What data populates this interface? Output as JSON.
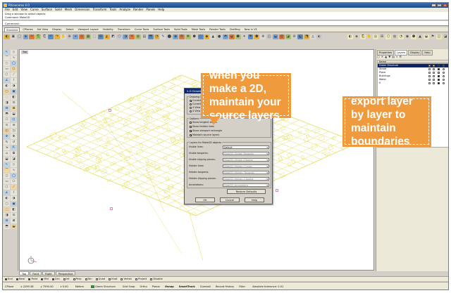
{
  "window": {
    "title": "Rhinoceros 4.0",
    "controls": [
      "_",
      "□",
      "x"
    ]
  },
  "menu": [
    "File",
    "Edit",
    "View",
    "Curve",
    "Surface",
    "Solid",
    "Mesh",
    "Dimension",
    "Transform",
    "Tools",
    "Analyze",
    "Render",
    "Panels",
    "Help"
  ],
  "command_history": [
    "Drag a window to select objects",
    "Command: Make2D"
  ],
  "command_prompt": "Command:",
  "ribbon_tabs": [
    "Standard",
    "CPlanes",
    "Set View",
    "Display",
    "Select",
    "Viewport Layout",
    "Visibility",
    "Transform",
    "Curve Tools",
    "Surface Tools",
    "Solid Tools",
    "Mesh Tools",
    "Render Tools",
    "Drafting",
    "New in V5"
  ],
  "viewport": {
    "label": "Top",
    "tabs": [
      "Top",
      "Front",
      "Right",
      "Perspective"
    ]
  },
  "dialog": {
    "title": "2-D Drawing Options",
    "drawing_layout_label": "Drawing layout",
    "layout_options": [
      "Current view",
      "Current CPlane",
      "4 View (USA)",
      "4 View (Europe)"
    ],
    "options_label": "Options",
    "checkboxes": [
      {
        "label": "Show tangent edges",
        "checked": false
      },
      {
        "label": "Show hidden lines",
        "checked": false
      },
      {
        "label": "Show viewport rectangle",
        "checked": true
      },
      {
        "label": "Maintain source layers",
        "checked": true
      }
    ],
    "layers_group_label": "Layers for Make2D objects",
    "layer_rows": [
      {
        "label": "Visible lines:",
        "value": "Default",
        "enabled": true
      },
      {
        "label": "Visible tangents:",
        "value": "Make2D::Visible::Tangents",
        "enabled": false
      },
      {
        "label": "Visible clipping planes:",
        "value": "Make2D::Visible::Clipping",
        "enabled": false
      },
      {
        "label": "Hidden lines:",
        "value": "Make2D::Hidden::Curves",
        "enabled": false
      },
      {
        "label": "Hidden tangents:",
        "value": "Make2D::Hidden::Tangents",
        "enabled": false
      },
      {
        "label": "Hidden clipping planes:",
        "value": "Make2D::Hidden::Clipping",
        "enabled": false
      },
      {
        "label": "Annotations:",
        "value": "Make2D::Annotations",
        "enabled": false
      }
    ],
    "restore_defaults": "Restore Defaults",
    "ok": "OK",
    "cancel": "Cancel",
    "help": "Help"
  },
  "panel": {
    "tabs": [
      "Properties",
      "Layers",
      "Display",
      "Help"
    ],
    "active_tab": "Layers",
    "toolbar_glyphs": [
      "□",
      "✕",
      "▲",
      "▼",
      "▤",
      "⌕",
      "⚙"
    ],
    "header": "Name",
    "layers": [
      {
        "name": "Green Structure",
        "color": "#000000",
        "selected": true
      },
      {
        "name": "Street",
        "color": "#000000",
        "selected": false
      },
      {
        "name": "Plaza",
        "color": "#ffffff",
        "selected": false
      },
      {
        "name": "Buildings",
        "color": "#000000",
        "selected": false
      },
      {
        "name": "Water",
        "color": "#000000",
        "selected": false
      },
      {
        "name": "0",
        "color": "#000000",
        "selected": false
      }
    ]
  },
  "osnap": [
    {
      "label": "End",
      "checked": true
    },
    {
      "label": "Near",
      "checked": true
    },
    {
      "label": "Point",
      "checked": true
    },
    {
      "label": "Mid",
      "checked": true
    },
    {
      "label": "Cen",
      "checked": true
    },
    {
      "label": "Int",
      "checked": false
    },
    {
      "label": "Perp",
      "checked": false
    },
    {
      "label": "Tan",
      "checked": false
    },
    {
      "label": "Quad",
      "checked": false
    },
    {
      "label": "Knot",
      "checked": false
    },
    {
      "label": "Vertex",
      "checked": false
    },
    {
      "label": "Project",
      "checked": false
    },
    {
      "label": "Disable",
      "checked": false
    }
  ],
  "status": {
    "cplane": "CPlane",
    "x": "x 2299.38",
    "y": "y 7590.00",
    "z": "z 0.00",
    "units": "Meters",
    "layer": "Green Structure",
    "toggles": [
      "Grid Snap",
      "Ortho",
      "Planar",
      "Osnap",
      "SmartTrack",
      "Gumball",
      "Record History",
      "Filter"
    ],
    "message": "Absolute tolerance: 0.01"
  },
  "callouts": {
    "make2d": "when you make a 2D, maintain your source layers",
    "export": "export layer by layer to maintain boundaries"
  },
  "colors": {
    "callout": "#ef9a3c",
    "drawing": "#e3dc55",
    "selection": "#0a246a"
  },
  "icons": {
    "toolbar": "rhino-toolbar-icons",
    "left_tools": "rhino-left-tool-icons"
  }
}
